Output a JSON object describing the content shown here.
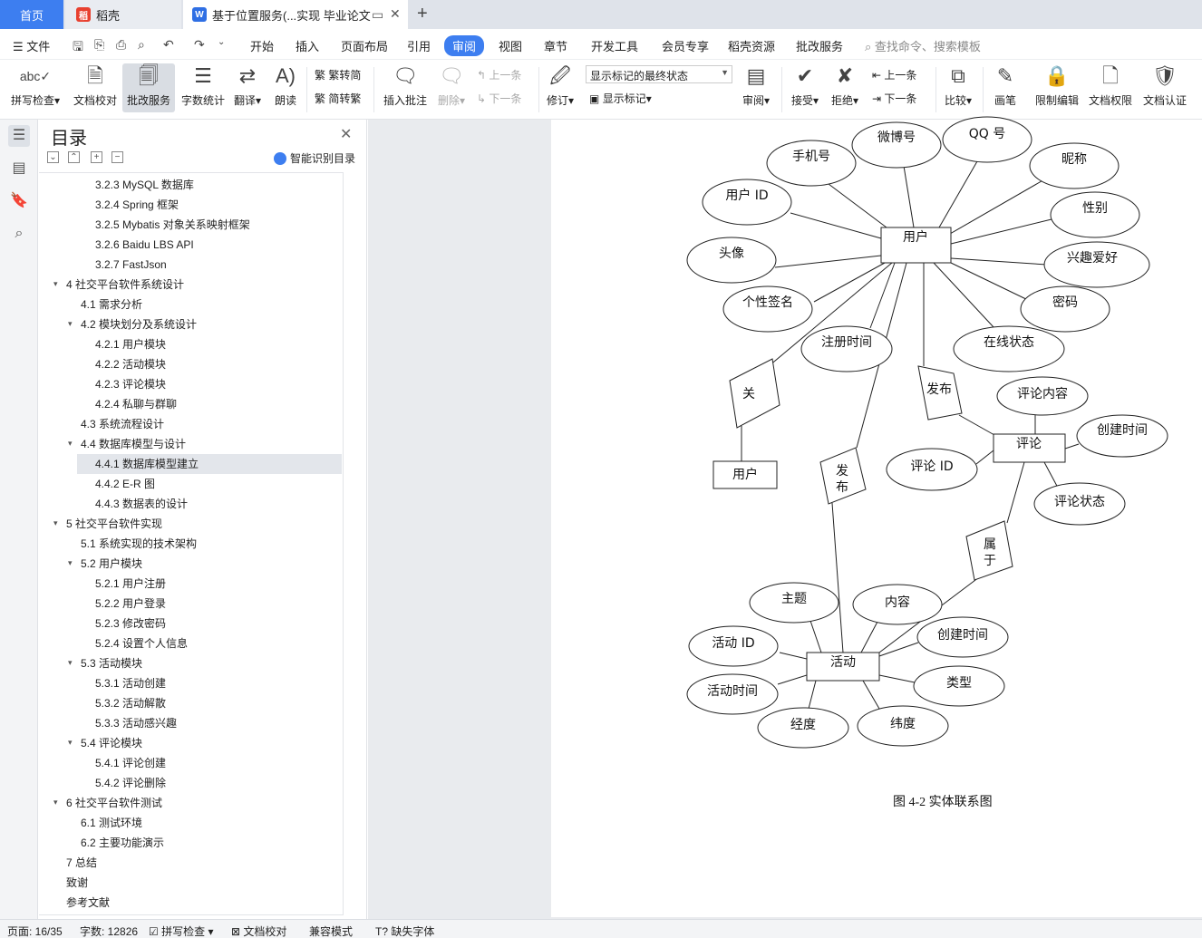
{
  "tabs": {
    "home": "首页",
    "daoke": "稻壳",
    "doc": "基于位置服务(...实现 毕业论文"
  },
  "menu": {
    "file": "文件",
    "items": [
      "开始",
      "插入",
      "页面布局",
      "引用",
      "审阅",
      "视图",
      "章节",
      "开发工具",
      "会员专享",
      "稻壳资源",
      "批改服务"
    ],
    "active": "审阅",
    "search": "查找命令、搜索模板"
  },
  "ribbon": {
    "spell": "拼写检查",
    "proof": "文档校对",
    "correct": "批改服务",
    "wordcount": "字数统计",
    "translate": "翻译",
    "read": "朗读",
    "trad": "繁转简",
    "simp": "简转繁",
    "insert_comment": "插入批注",
    "delete": "删除",
    "prev": "上一条",
    "next": "下一条",
    "revise": "修订",
    "mark_state": "显示标记的最终状态",
    "show_marks": "显示标记",
    "review": "审阅",
    "accept": "接受",
    "reject": "拒绝",
    "prev2": "上一条",
    "next2": "下一条",
    "compare": "比较",
    "pen": "画笔",
    "restrict": "限制编辑",
    "rights": "文档权限",
    "cert": "文档认证"
  },
  "toc": {
    "title": "目录",
    "smart": "智能识别目录",
    "items": [
      {
        "text": "3.2.3 MySQL  数据库",
        "level": 3
      },
      {
        "text": "3.2.4 Spring 框架",
        "level": 3
      },
      {
        "text": "3.2.5 Mybatis  对象关系映射框架",
        "level": 3
      },
      {
        "text": "3.2.6 Baidu LBS API",
        "level": 3
      },
      {
        "text": "3.2.7 FastJson",
        "level": 3
      },
      {
        "text": "4  社交平台软件系统设计",
        "level": 1,
        "arrow": true
      },
      {
        "text": "4.1  需求分析",
        "level": 2
      },
      {
        "text": "4.2  模块划分及系统设计",
        "level": 2,
        "arrow": true
      },
      {
        "text": "4.2.1  用户模块",
        "level": 3
      },
      {
        "text": "4.2.2  活动模块",
        "level": 3
      },
      {
        "text": "4.2.3  评论模块",
        "level": 3
      },
      {
        "text": "4.2.4  私聊与群聊",
        "level": 3
      },
      {
        "text": "4.3  系统流程设计",
        "level": 2
      },
      {
        "text": "4.4  数据库模型与设计",
        "level": 2,
        "arrow": true
      },
      {
        "text": "4.4.1  数据库模型建立",
        "level": 3,
        "selected": true
      },
      {
        "text": "4.4.2 E-R 图",
        "level": 3
      },
      {
        "text": "4.4.3  数据表的设计",
        "level": 3
      },
      {
        "text": "5  社交平台软件实现",
        "level": 1,
        "arrow": true
      },
      {
        "text": "5.1  系统实现的技术架构",
        "level": 2
      },
      {
        "text": "5.2  用户模块",
        "level": 2,
        "arrow": true
      },
      {
        "text": "5.2.1  用户注册",
        "level": 3
      },
      {
        "text": "5.2.2  用户登录",
        "level": 3
      },
      {
        "text": "5.2.3  修改密码",
        "level": 3
      },
      {
        "text": "5.2.4  设置个人信息",
        "level": 3
      },
      {
        "text": "5.3  活动模块",
        "level": 2,
        "arrow": true
      },
      {
        "text": "5.3.1  活动创建",
        "level": 3
      },
      {
        "text": "5.3.2  活动解散",
        "level": 3
      },
      {
        "text": "5.3.3  活动感兴趣",
        "level": 3
      },
      {
        "text": "5.4  评论模块",
        "level": 2,
        "arrow": true
      },
      {
        "text": "5.4.1  评论创建",
        "level": 3
      },
      {
        "text": "5.4.2  评论删除",
        "level": 3
      },
      {
        "text": "6  社交平台软件测试",
        "level": 1,
        "arrow": true
      },
      {
        "text": "6.1  测试环境",
        "level": 2
      },
      {
        "text": "6.2  主要功能演示",
        "level": 2
      },
      {
        "text": "7  总结",
        "level": 1
      },
      {
        "text": "致谢",
        "level": 1
      },
      {
        "text": "参考文献",
        "level": 1
      }
    ]
  },
  "er": {
    "entities": {
      "user": "用户",
      "comment": "评论",
      "activity": "活动",
      "user2": "用户"
    },
    "user_attrs": [
      "手机号",
      "微博号",
      "QQ 号",
      "昵称",
      "用户 ID",
      "性别",
      "头像",
      "兴趣爱好",
      "个性签名",
      "密码",
      "注册时间",
      "在线状态"
    ],
    "relations": {
      "guan": "关",
      "fabu1": "发布",
      "fabu2_top": "发",
      "fabu2_bottom": "布",
      "shu_top": "属",
      "shu_bottom": "于"
    },
    "comment_attrs": [
      "评论内容",
      "创建时间",
      "评论 ID",
      "评论状态"
    ],
    "activity_attrs": [
      "主题",
      "内容",
      "活动 ID",
      "创建时间",
      "活动时间",
      "类型",
      "经度",
      "纬度"
    ],
    "caption": "图 4-2 实体联系图"
  },
  "status": {
    "page": "页面: 16/35",
    "words": "字数: 12826",
    "spell": "拼写检查",
    "proof": "文档校对",
    "compat": "兼容模式",
    "missing_font": "缺失字体"
  }
}
